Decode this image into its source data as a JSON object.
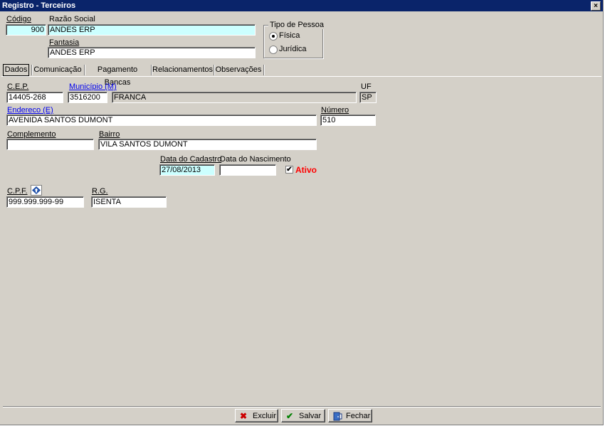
{
  "window": {
    "title": "Registro - Terceiros",
    "close": "×"
  },
  "header": {
    "codigo_label": "Código",
    "codigo_value": "900",
    "razao_label": "Razão Social",
    "razao_value": "ANDES ERP",
    "fantasia_label": "Fantasia",
    "fantasia_value": "ANDES ERP",
    "tipo_title": "Tipo de Pessoa",
    "tipo_fisica": "Física",
    "tipo_juridica": "Jurídica",
    "tipo_selected": "Física"
  },
  "tabs": [
    "Dados",
    "Comunicação",
    "Pagamento Bancas",
    "Relacionamentos",
    "Observações"
  ],
  "dados": {
    "cep_label": "C.E.P.",
    "cep_value": "14405-268",
    "municipio_label": "Município (M)",
    "municipio_code": "3516200",
    "municipio_name": "FRANCA",
    "uf_label": "UF",
    "uf_value": "SP",
    "endereco_label": "Endereco (E)",
    "endereco_value": "AVENIDA SANTOS DUMONT",
    "numero_label": "Número",
    "numero_value": "510",
    "complemento_label": "Complemento",
    "complemento_value": "",
    "bairro_label": "Bairro",
    "bairro_value": "VILA SANTOS DUMONT",
    "data_cadastro_label": "Data do Cadastro",
    "data_cadastro_value": "27/08/2013",
    "data_nascimento_label": "Data do Nascimento",
    "data_nascimento_value": "",
    "ativo_label": "Ativo",
    "ativo_checked": "✔",
    "cpf_label": "C.P.F.",
    "cpf_value": "999.999.999-99",
    "rg_label": "R.G.",
    "rg_value": "ISENTA"
  },
  "buttons": {
    "excluir": "Excluir",
    "salvar": "Salvar",
    "fechar": "Fechar",
    "excluir_icon": "✖",
    "salvar_icon": "✔"
  },
  "colors": {
    "title_bg": "#0a246a",
    "window_bg": "#d4d0c8",
    "cyan_field": "#ccffff",
    "ativo": "#ff0000"
  }
}
